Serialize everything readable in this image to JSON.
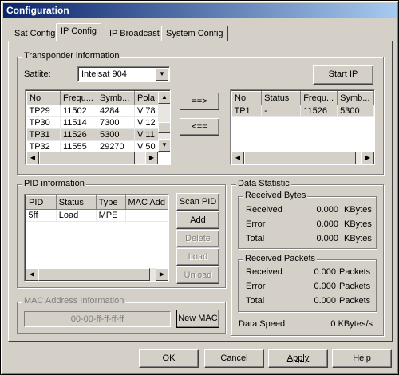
{
  "window": {
    "title": "Configuration"
  },
  "tabs": [
    {
      "label": "Sat Config",
      "active": false
    },
    {
      "label": "IP Config",
      "active": true
    },
    {
      "label": "IP Broadcast",
      "active": false
    },
    {
      "label": "System Config",
      "active": false
    }
  ],
  "transponder": {
    "legend": "Transponder information",
    "satellite_label": "Satlite:",
    "satellite_value": "Intelsat 904",
    "start_ip": "Start IP",
    "add_arrow": "==>",
    "remove_arrow": "<==",
    "left_columns": [
      "No",
      "Frequ...",
      "Symb...",
      "Pola"
    ],
    "left_rows": [
      [
        "TP29",
        "11502",
        "4284",
        "V 78"
      ],
      [
        "TP30",
        "11514",
        "7300",
        "V 12"
      ],
      [
        "TP31",
        "11526",
        "5300",
        "V 11"
      ],
      [
        "TP32",
        "11555",
        "29270",
        "V 50"
      ]
    ],
    "right_columns": [
      "No",
      "Status",
      "Frequ...",
      "Symb..."
    ],
    "right_rows": [
      [
        "TP1",
        "-",
        "11526",
        "5300"
      ]
    ]
  },
  "pid": {
    "legend": "PID information",
    "columns": [
      "PID",
      "Status",
      "Type",
      "MAC Add"
    ],
    "rows": [
      [
        "5ff",
        "Load",
        "MPE",
        ""
      ]
    ],
    "buttons": {
      "scan": "Scan PID",
      "add": "Add",
      "delete": "Delete",
      "load": "Load",
      "unload": "Unload"
    }
  },
  "mac": {
    "legend": "MAC Address Information",
    "value": "00-00-ff-ff-ff-ff",
    "new_mac": "New MAC"
  },
  "stats": {
    "legend": "Data Statistic",
    "bytes_legend": "Received Bytes",
    "bytes": [
      {
        "label": "Received",
        "value": "0.000",
        "unit": "KBytes"
      },
      {
        "label": "Error",
        "value": "0.000",
        "unit": "KBytes"
      },
      {
        "label": "Total",
        "value": "0.000",
        "unit": "KBytes"
      }
    ],
    "packets_legend": "Received Packets",
    "packets": [
      {
        "label": "Received",
        "value": "0.000",
        "unit": "Packets"
      },
      {
        "label": "Error",
        "value": "0.000",
        "unit": "Packets"
      },
      {
        "label": "Total",
        "value": "0.000",
        "unit": "Packets"
      }
    ],
    "speed_label": "Data Speed",
    "speed_value": "0 KBytes/s"
  },
  "footer": {
    "ok": "OK",
    "cancel": "Cancel",
    "apply": "Apply",
    "help": "Help"
  }
}
